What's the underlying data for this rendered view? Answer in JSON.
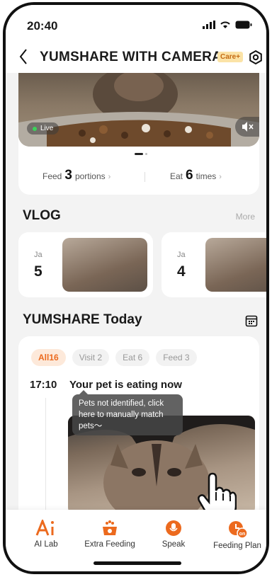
{
  "status_bar": {
    "time": "20:40"
  },
  "header": {
    "title": "YUMSHARE WITH CAMERA",
    "badge": "Care+"
  },
  "live_view": {
    "live_label": "Live"
  },
  "stats": {
    "feed_label": "Feed",
    "feed_value": "3",
    "feed_unit": "portions",
    "eat_label": "Eat",
    "eat_value": "6",
    "eat_unit": "times"
  },
  "vlog": {
    "title": "VLOG",
    "more": "More",
    "items": [
      {
        "month": "Ja",
        "day": "5"
      },
      {
        "month": "Ja",
        "day": "4"
      }
    ]
  },
  "today": {
    "title": "YUMSHARE Today",
    "filters": [
      "All16",
      "Visit 2",
      "Eat 6",
      "Feed 3"
    ],
    "event_time": "17:10",
    "event_text": "Your pet is eating now",
    "tooltip": "Pets not identified, click here to manually match pets～"
  },
  "tabbar": {
    "items": [
      {
        "label": "AI Lab",
        "icon": "ai-icon"
      },
      {
        "label": "Extra Feeding",
        "icon": "bowl-icon"
      },
      {
        "label": "Speak",
        "icon": "mic-icon"
      },
      {
        "label": "Feeding Plan",
        "icon": "clock-on-icon"
      }
    ]
  },
  "colors": {
    "accent": "#ec6a1e",
    "badge_bg": "#fbe3a7"
  }
}
